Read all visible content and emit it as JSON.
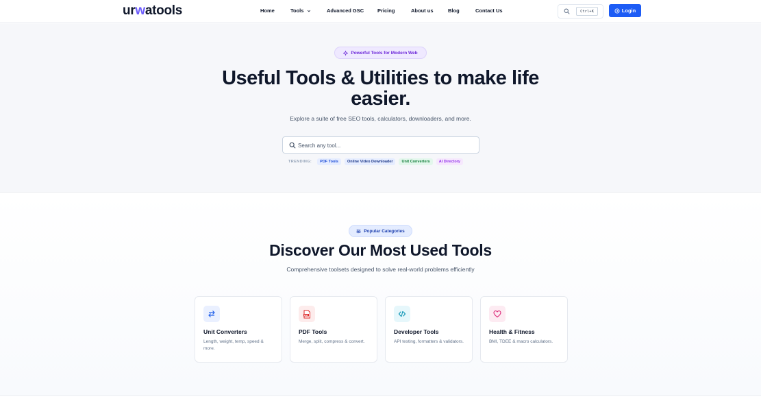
{
  "header": {
    "logo": {
      "part1": "ur",
      "part2": "w",
      "part3": "atools"
    },
    "nav": [
      {
        "label": "Home"
      },
      {
        "label": "Tools"
      },
      {
        "label": "Advanced GSC"
      },
      {
        "label": "Pricing"
      },
      {
        "label": "About us"
      },
      {
        "label": "Blog"
      },
      {
        "label": "Contact Us"
      }
    ],
    "shortcut": "Ctrl+K",
    "login_label": "Login"
  },
  "hero": {
    "badge": "Powerful Tools for Modern Web",
    "title": "Useful Tools & Utilities to make life easier.",
    "subtitle": "Explore a suite of free SEO tools, calculators, downloaders, and more.",
    "search_placeholder": "Search any tool...",
    "trending_label": "TRENDING:",
    "trending": [
      {
        "label": "PDF Tools",
        "bg": "#e6edff",
        "fg": "#1d4ed8"
      },
      {
        "label": "Online Video Downloader",
        "bg": "#e6edff",
        "fg": "#1e3a8a"
      },
      {
        "label": "Unit Converters",
        "bg": "#e3f7ec",
        "fg": "#15803d"
      },
      {
        "label": "AI Directory",
        "bg": "#f6e8fd",
        "fg": "#9333ea"
      }
    ]
  },
  "categories": {
    "badge": "Popular Categories",
    "title": "Discover Our Most Used Tools",
    "subtitle": "Comprehensive toolsets designed to solve real-world problems efficiently",
    "cards": [
      {
        "title": "Unit Converters",
        "desc": "Length, weight, temp, speed & more.",
        "icon": "arrows-exchange-icon",
        "icon_bg": "#eaf0ff",
        "icon_color": "#2563eb"
      },
      {
        "title": "PDF Tools",
        "desc": "Merge, split, compress & convert.",
        "icon": "pdf-file-icon",
        "icon_bg": "#fdecec",
        "icon_color": "#dc2626"
      },
      {
        "title": "Developer Tools",
        "desc": "API testing, formatters & validators.",
        "icon": "code-icon",
        "icon_bg": "#e6f7fb",
        "icon_color": "#0891b2"
      },
      {
        "title": "Health & Fitness",
        "desc": "BMI, TDEE & macro calculators.",
        "icon": "heart-icon",
        "icon_bg": "#fdebf2",
        "icon_color": "#db2777"
      }
    ]
  },
  "colors": {
    "brand_blue": "#1d5cf5",
    "logo_accent": "#6d5dfc",
    "badge_purple": "#6d28d9"
  }
}
